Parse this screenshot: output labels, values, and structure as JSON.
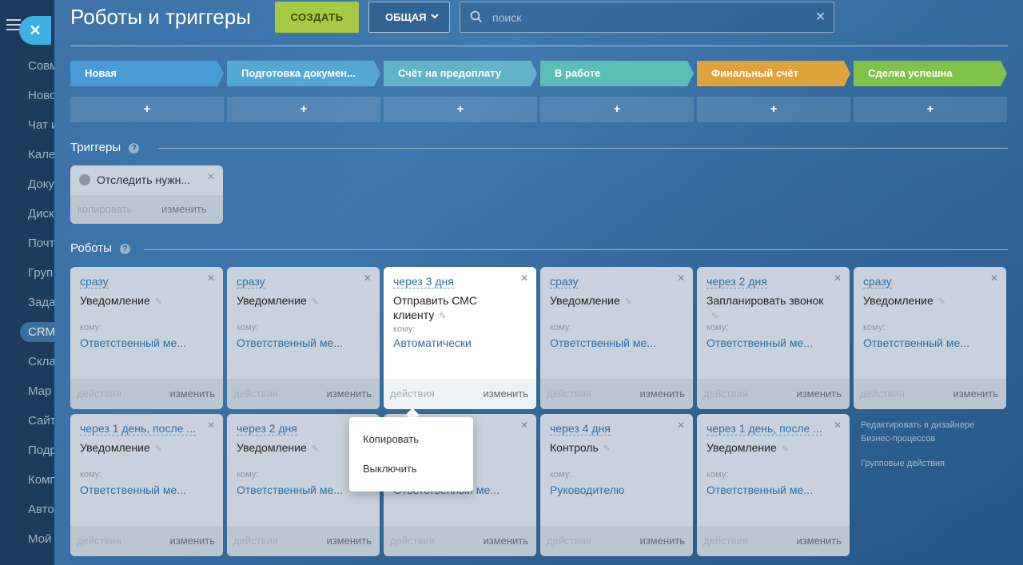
{
  "sidebar": {
    "items": [
      "Совм",
      "Ново",
      "Чат и",
      "Кале",
      "Доку",
      "Диск",
      "Почт",
      "Груп",
      "Зада",
      "CRM",
      "Скла",
      "Мар",
      "Сайт",
      "Подр",
      "Комп",
      "Авто",
      "Мой"
    ]
  },
  "header": {
    "title": "Роботы и триггеры",
    "create_label": "СОЗДАТЬ",
    "general_label": "ОБЩАЯ",
    "search_placeholder": "поиск"
  },
  "stages": [
    {
      "label": "Новая",
      "color": "#4a9ad6"
    },
    {
      "label": "Подготовка докумен...",
      "color": "#56a8d4"
    },
    {
      "label": "Счёт на предоплату",
      "color": "#62b2c9"
    },
    {
      "label": "В работе",
      "color": "#5cbdb4"
    },
    {
      "label": "Финальный счёт",
      "color": "#e0a33c"
    },
    {
      "label": "Сделка успешна",
      "color": "#7fc24a"
    }
  ],
  "stage_add_label": "+",
  "triggers": {
    "title": "Триггеры",
    "card": {
      "label": "Отследить нужн...",
      "copy": "копировать",
      "edit": "изменить"
    }
  },
  "robots": {
    "title": "Роботы",
    "row1": [
      {
        "delay": "сразу",
        "title": "Уведомление",
        "to": "кому:",
        "resp": "Ответственный ме...",
        "actions": "действия",
        "edit": "изменить"
      },
      {
        "delay": "сразу",
        "title": "Уведомление",
        "to": "кому:",
        "resp": "Ответственный ме...",
        "actions": "действия",
        "edit": "изменить"
      },
      {
        "delay": "через 3 дня",
        "title": "Отправить СМС клиенту",
        "to": "кому:",
        "resp": "Автоматически",
        "actions": "действия",
        "edit": "изменить"
      },
      {
        "delay": "сразу",
        "title": "Уведомление",
        "to": "кому:",
        "resp": "Ответственный ме...",
        "actions": "действия",
        "edit": "изменить"
      },
      {
        "delay": "через 2 дня",
        "title": "Запланировать звонок",
        "to": "кому:",
        "resp": "Ответственный ме...",
        "actions": "действия",
        "edit": "изменить"
      },
      {
        "delay": "сразу",
        "title": "Уведомление",
        "to": "кому:",
        "resp": "Ответственный ме...",
        "actions": "действия",
        "edit": "изменить"
      }
    ],
    "row2": [
      {
        "delay": "через 1 день, после ...",
        "title": "Уведомление",
        "to": "кому:",
        "resp": "Ответственный ме...",
        "actions": "действия",
        "edit": "изменить"
      },
      {
        "delay": "через 2 дня",
        "title": "Уведомление",
        "to": "кому:",
        "resp": "Ответственный ме...",
        "actions": "действия",
        "edit": "изменить"
      },
      {
        "delay": "",
        "title": "",
        "to": "",
        "resp": "Ответственный ме...",
        "actions": "действия",
        "edit": "изменить"
      },
      {
        "delay": "через 4 дня",
        "title": "Контроль",
        "to": "кому:",
        "resp": "Руководителю",
        "actions": "действия",
        "edit": "изменить"
      },
      {
        "delay": "через 1 день, после ...",
        "title": "Уведомление",
        "to": "кому:",
        "resp": "Ответственный ме...",
        "actions": "действия",
        "edit": "изменить"
      }
    ]
  },
  "context_menu": {
    "copy": "Копировать",
    "disable": "Выключить"
  },
  "side_links": {
    "designer": "Редактировать в дизайнере Бизнес-процессов",
    "group": "Групповые действия"
  }
}
